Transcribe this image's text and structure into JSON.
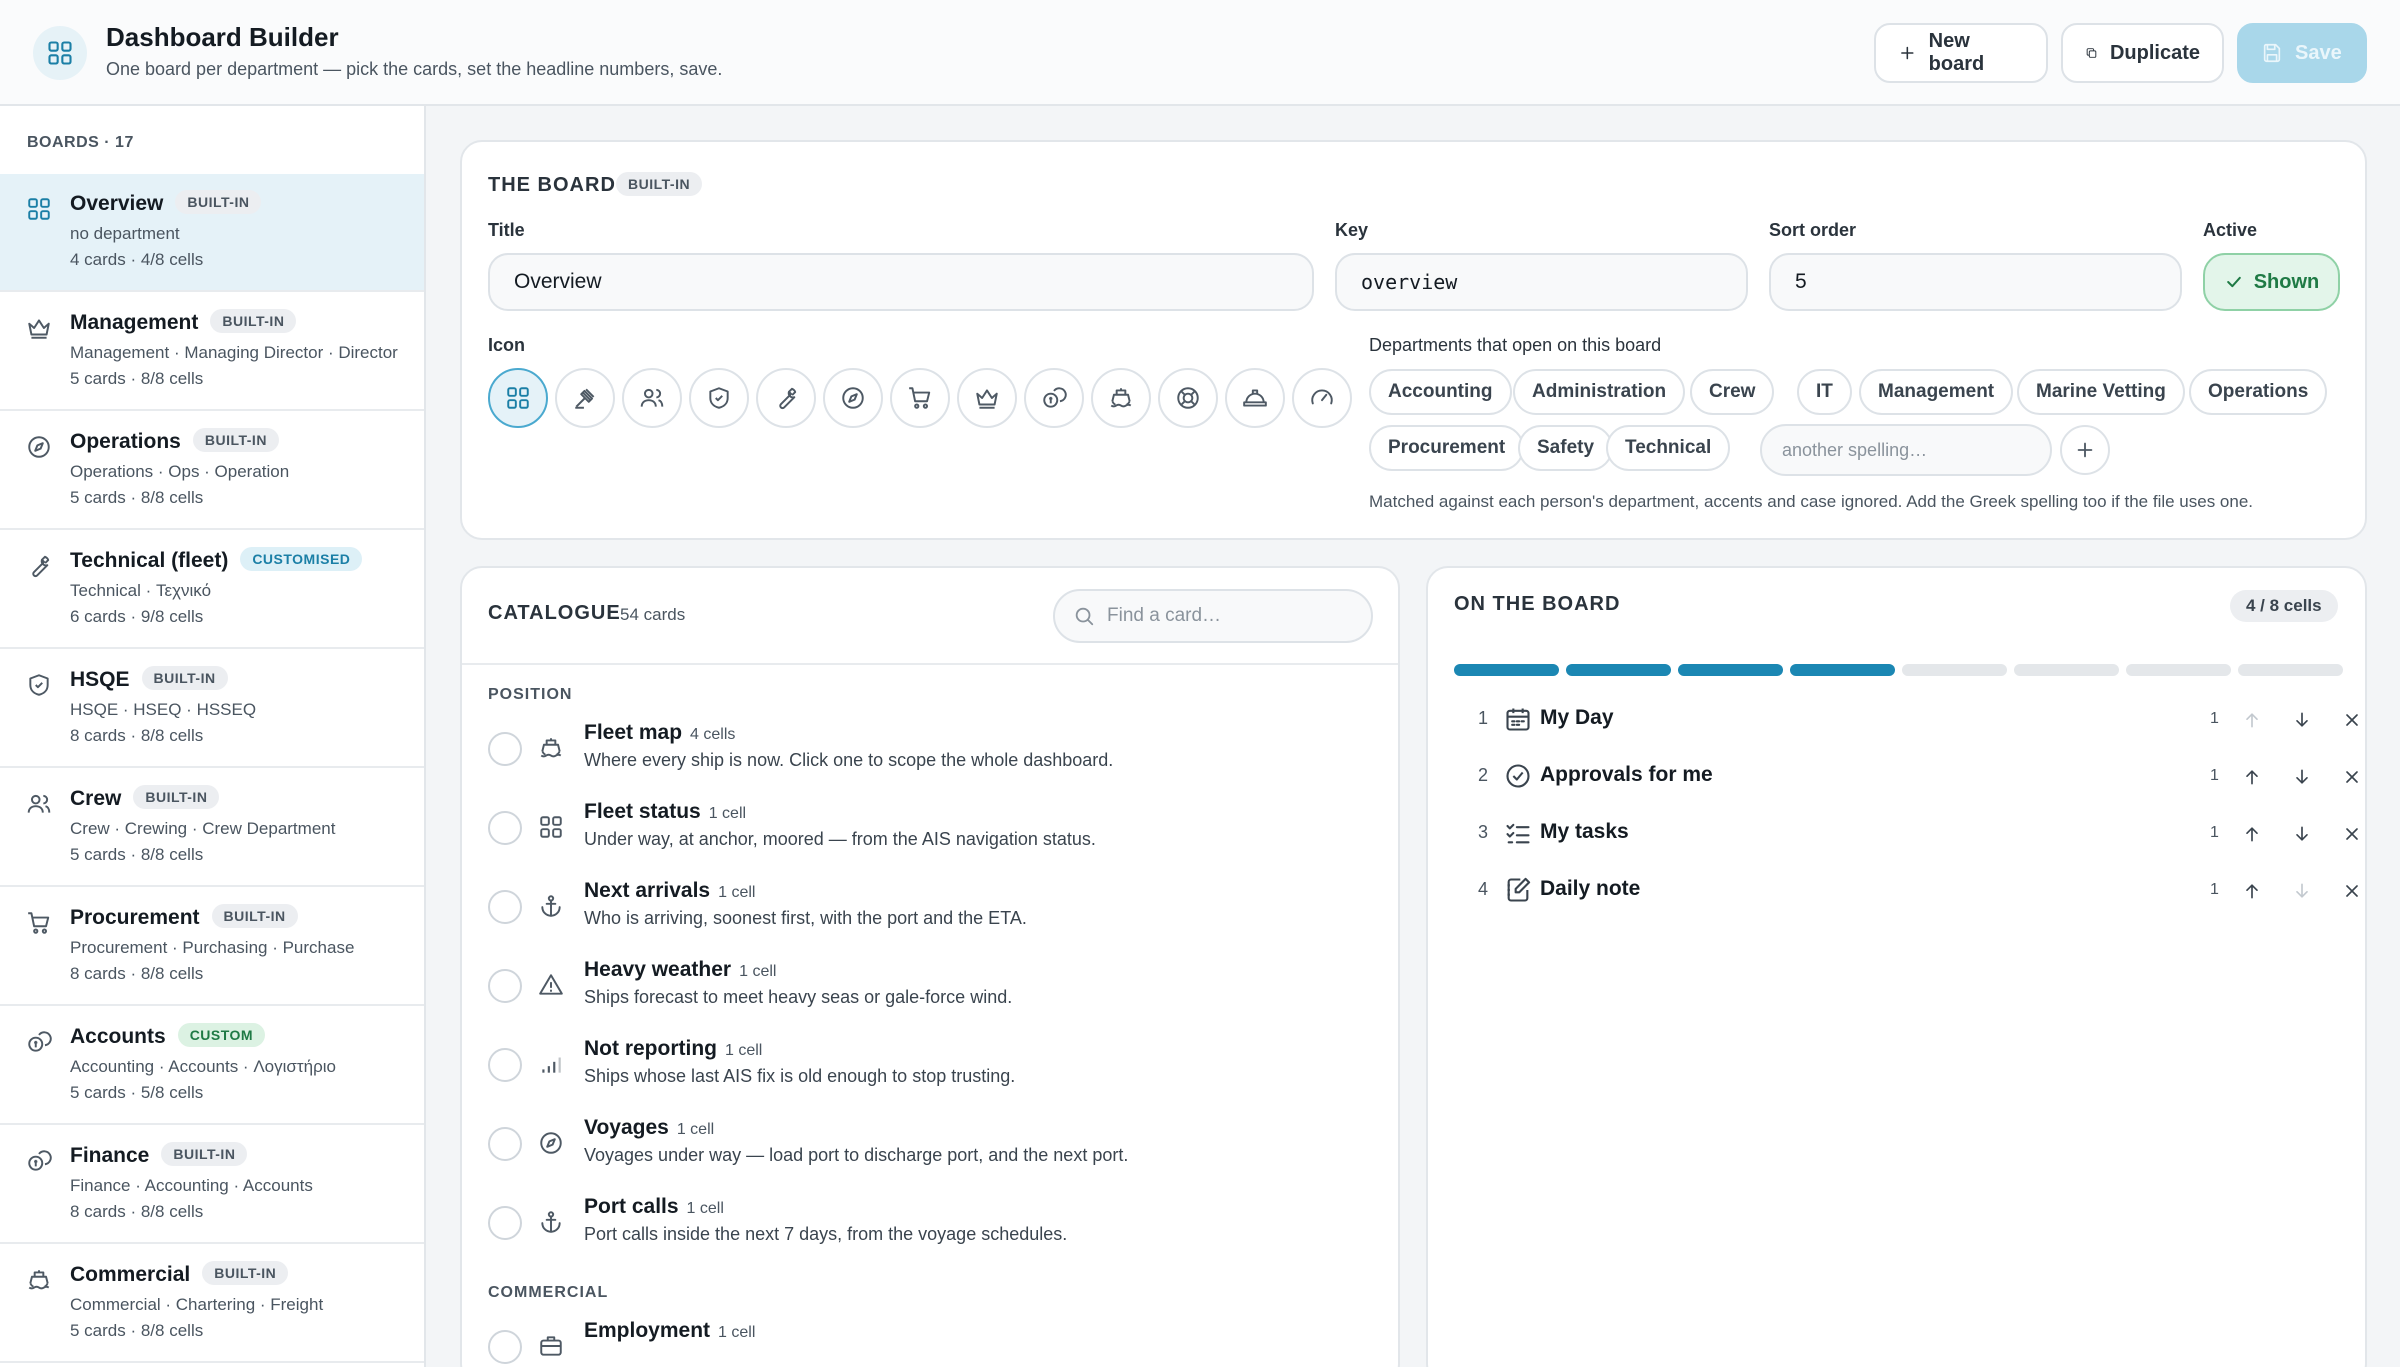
{
  "header": {
    "title": "Dashboard Builder",
    "subtitle": "One board per department — pick the cards, set the headline numbers, save.",
    "new_board": "New board",
    "duplicate": "Duplicate",
    "save": "Save"
  },
  "sidebar": {
    "heading": "BOARDS · 17",
    "items": [
      {
        "name": "Overview",
        "badge": "BUILT-IN",
        "aliases": "no department",
        "stats": "4 cards · 4/8 cells",
        "icon": "grid-icon"
      },
      {
        "name": "Management",
        "badge": "BUILT-IN",
        "aliases": "Management · Managing Director · Director",
        "stats": "5 cards · 8/8 cells",
        "icon": "crown-icon"
      },
      {
        "name": "Operations",
        "badge": "BUILT-IN",
        "aliases": "Operations · Ops · Operation",
        "stats": "5 cards · 8/8 cells",
        "icon": "compass-icon"
      },
      {
        "name": "Technical (fleet)",
        "badge": "CUSTOMISED",
        "aliases": "Technical · Τεχνικό",
        "stats": "6 cards · 9/8 cells",
        "icon": "wrench-icon"
      },
      {
        "name": "HSQE",
        "badge": "BUILT-IN",
        "aliases": "HSQE · HSEQ · HSSEQ",
        "stats": "8 cards · 8/8 cells",
        "icon": "shield-icon"
      },
      {
        "name": "Crew",
        "badge": "BUILT-IN",
        "aliases": "Crew · Crewing · Crew Department",
        "stats": "5 cards · 8/8 cells",
        "icon": "people-icon"
      },
      {
        "name": "Procurement",
        "badge": "BUILT-IN",
        "aliases": "Procurement · Purchasing · Purchase",
        "stats": "8 cards · 8/8 cells",
        "icon": "cart-icon"
      },
      {
        "name": "Accounts",
        "badge": "CUSTOM",
        "aliases": "Accounting · Accounts · Λογιστήριο",
        "stats": "5 cards · 5/8 cells",
        "icon": "coins-icon"
      },
      {
        "name": "Finance",
        "badge": "BUILT-IN",
        "aliases": "Finance · Accounting · Accounts",
        "stats": "8 cards · 8/8 cells",
        "icon": "coins-icon"
      },
      {
        "name": "Commercial",
        "badge": "BUILT-IN",
        "aliases": "Commercial · Chartering · Freight",
        "stats": "5 cards · 8/8 cells",
        "icon": "ship-icon"
      }
    ]
  },
  "board": {
    "section_title": "THE BOARD",
    "badge": "BUILT-IN",
    "title_label": "Title",
    "title_value": "Overview",
    "key_label": "Key",
    "key_value": "overview",
    "sort_label": "Sort order",
    "sort_value": "5",
    "active_label": "Active",
    "active_value": "Shown",
    "icon_label": "Icon",
    "icons": [
      "grid-icon",
      "gavel-icon",
      "people-icon",
      "shield-icon",
      "wrench-icon",
      "compass-icon",
      "cart-icon",
      "crown-icon",
      "coins-icon",
      "ship-icon",
      "lifebuoy-icon",
      "hardhat-icon",
      "gauge-icon"
    ],
    "selected_icon": "grid-icon",
    "dept_label": "Departments that open on this board",
    "departments": [
      "Accounting",
      "Administration",
      "Crew",
      "IT",
      "Management",
      "Marine Vetting",
      "Operations",
      "Procurement",
      "Safety",
      "Technical"
    ],
    "dept_placeholder": "another spelling…",
    "helper": "Matched against each person's department, accents and case ignored. Add the Greek spelling too if the file uses one."
  },
  "catalogue": {
    "title": "CATALOGUE",
    "count": "54 cards",
    "search_placeholder": "Find a card…",
    "groups": [
      {
        "label": "POSITION",
        "cards": [
          {
            "title": "Fleet map",
            "cells": "4 cells",
            "desc": "Where every ship is now. Click one to scope the whole dashboard.",
            "icon": "ship-icon"
          },
          {
            "title": "Fleet status",
            "cells": "1 cell",
            "desc": "Under way, at anchor, moored — from the AIS navigation status.",
            "icon": "grid-icon"
          },
          {
            "title": "Next arrivals",
            "cells": "1 cell",
            "desc": "Who is arriving, soonest first, with the port and the ETA.",
            "icon": "anchor-icon"
          },
          {
            "title": "Heavy weather",
            "cells": "1 cell",
            "desc": "Ships forecast to meet heavy seas or gale-force wind.",
            "icon": "warning-icon"
          },
          {
            "title": "Not reporting",
            "cells": "1 cell",
            "desc": "Ships whose last AIS fix is old enough to stop trusting.",
            "icon": "signal-icon"
          },
          {
            "title": "Voyages",
            "cells": "1 cell",
            "desc": "Voyages under way — load port to discharge port, and the next port.",
            "icon": "compass-icon"
          },
          {
            "title": "Port calls",
            "cells": "1 cell",
            "desc": "Port calls inside the next 7 days, from the voyage schedules.",
            "icon": "anchor-icon"
          }
        ]
      },
      {
        "label": "COMMERCIAL",
        "cards": [
          {
            "title": "Employment",
            "cells": "1 cell",
            "desc": "",
            "icon": "briefcase-icon"
          }
        ]
      }
    ]
  },
  "on_board": {
    "title": "ON THE BOARD",
    "cells_used": "4 / 8 cells",
    "used": 4,
    "capacity": 8,
    "items": [
      {
        "num": "1",
        "name": "My Day",
        "size": "1",
        "icon": "calendar-icon"
      },
      {
        "num": "2",
        "name": "Approvals for me",
        "size": "1",
        "icon": "check-circle-icon"
      },
      {
        "num": "3",
        "name": "My tasks",
        "size": "1",
        "icon": "checklist-icon"
      },
      {
        "num": "4",
        "name": "Daily note",
        "size": "1",
        "icon": "note-icon"
      }
    ]
  }
}
